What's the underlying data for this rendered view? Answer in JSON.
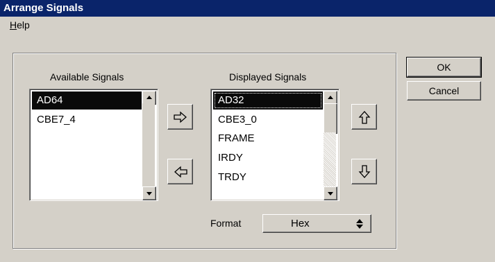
{
  "window": {
    "title": "Arrange Signals"
  },
  "menu": {
    "help": {
      "label_first": "H",
      "label_rest": "elp"
    }
  },
  "available": {
    "caption": "Available Signals",
    "items": [
      "AD64",
      "CBE7_4"
    ],
    "selected_index": 0
  },
  "displayed": {
    "caption": "Displayed Signals",
    "items": [
      "AD32",
      "CBE3_0",
      "FRAME",
      "IRDY",
      "TRDY"
    ],
    "selected_index": 0
  },
  "buttons": {
    "ok": "OK",
    "cancel": "Cancel"
  },
  "icons": {
    "move_right": "arrow-right-outline-icon",
    "move_left": "arrow-left-outline-icon",
    "move_up": "arrow-up-outline-icon",
    "move_down": "arrow-down-outline-icon",
    "scroll_up": "triangle-up-icon",
    "scroll_down": "triangle-down-icon",
    "spinner": "up-down-triangles-icon"
  },
  "format": {
    "label": "Format",
    "value": "Hex"
  },
  "colors": {
    "titlebar": "#0a246a",
    "face": "#d4d0c8",
    "selection": "#0a0a0a"
  }
}
